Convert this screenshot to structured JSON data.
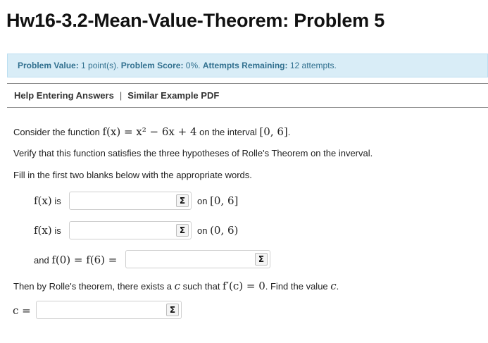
{
  "header": {
    "title": "Hw16-3.2-Mean-Value-Theorem: Problem 5"
  },
  "info": {
    "value_label": "Problem Value:",
    "value_text": "1 point(s).",
    "score_label": "Problem Score:",
    "score_text": "0%.",
    "attempts_label": "Attempts Remaining:",
    "attempts_text": "12 attempts."
  },
  "links": {
    "help": "Help Entering Answers",
    "separator": "|",
    "example": "Similar Example PDF"
  },
  "problem": {
    "line1_prefix": "Consider the function ",
    "line1_func": "f(x) = x² − 6x + 4",
    "line1_mid": " on the interval ",
    "line1_interval": "[0, 6]",
    "line1_suffix": ".",
    "line2": "Verify that this function satisfies the three hypotheses of Rolle's Theorem on the inverval.",
    "line3": "Fill in the first two blanks below with the appropriate words.",
    "row1_label_math": "f(x)",
    "row1_label_text": " is",
    "row1_after_text": "on ",
    "row1_after_math": "[0, 6]",
    "row2_label_math": "f(x)",
    "row2_label_text": " is",
    "row2_after_text": "on ",
    "row2_after_math": "(0, 6)",
    "row3_label_text": "and ",
    "row3_label_math": "f(0) = f(6) =",
    "line4_prefix": "Then by Rolle's theorem, there exists a ",
    "line4_c": "c",
    "line4_mid": " such that ",
    "line4_eq": "f′(c) = 0",
    "line4_suffix": ". Find the value ",
    "line4_c2": "c",
    "line4_end": ".",
    "row4_label_math": "c ="
  },
  "inputs": {
    "answer1": "",
    "answer2": "",
    "answer3": "",
    "answer4": ""
  },
  "icons": {
    "sigma_glyph": "Σ",
    "sigma_name": "equation-editor-icon"
  },
  "colors": {
    "info_bg": "#d9edf7",
    "info_text": "#31708f"
  }
}
